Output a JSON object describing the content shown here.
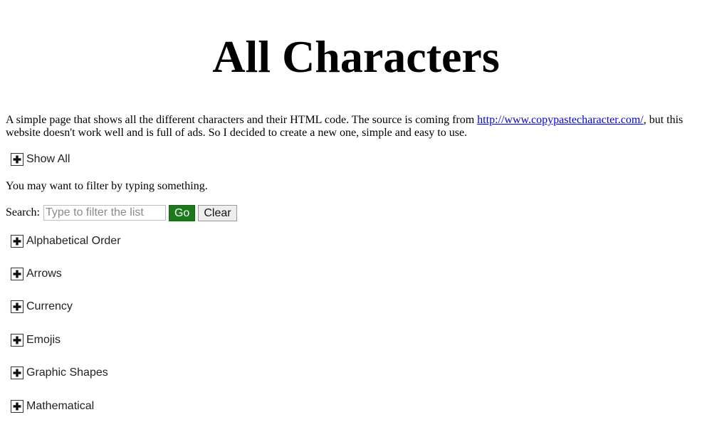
{
  "page": {
    "title": "All Characters",
    "intro": {
      "text_before": "A simple page that shows all the different characters and their HTML code. The source is coming from ",
      "link_text": "http://www.copypastecharacter.com/",
      "text_after": ", but this website doesn't work well and is full of ads. So I decided to create a new one, simple and easy to use."
    },
    "show_all_label": "Show All",
    "filter_note": "You may want to filter by typing something.",
    "search": {
      "label": "Search:",
      "placeholder": "Type to filter the list",
      "value": "",
      "go_label": "Go",
      "clear_label": "Clear"
    },
    "categories": [
      {
        "label": "Alphabetical Order",
        "icon": "plus-icon"
      },
      {
        "label": "Arrows",
        "icon": "plus-icon"
      },
      {
        "label": "Currency",
        "icon": "plus-icon"
      },
      {
        "label": "Emojis",
        "icon": "plus-icon"
      },
      {
        "label": "Graphic Shapes",
        "icon": "plus-icon"
      },
      {
        "label": "Mathematical",
        "icon": "plus-icon"
      }
    ],
    "colors": {
      "link": "#0000ee",
      "go_button": "#1a7a1a",
      "clear_button": "#eeeeee"
    }
  }
}
